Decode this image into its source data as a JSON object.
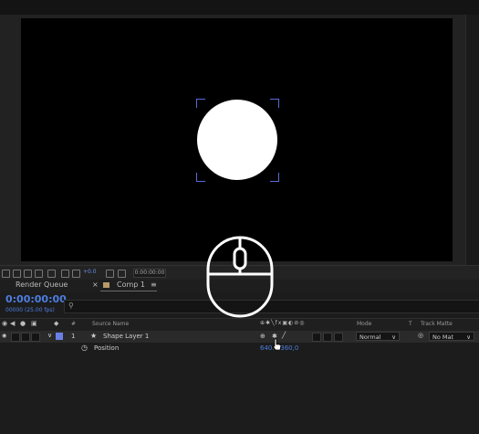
{
  "tabs": {
    "render_queue": "Render Queue",
    "close": "×",
    "comp": "Comp 1",
    "menu": "≡"
  },
  "viewer_toolbar": {
    "camera_value": "0:00:00:00",
    "magnify_label": "+0.0"
  },
  "timeline": {
    "timecode": "0:00:00:00",
    "frame_info": "00000 (25.00 fps)",
    "search_placeholder": ""
  },
  "columns": {
    "hash": "#",
    "source_name": "Source Name",
    "mode": "Mode",
    "t": "T",
    "track_matte": "Track Matte"
  },
  "layer": {
    "index": "1",
    "name": "Shape Layer 1",
    "label_color": "#6b7fe6",
    "mode_value": "Normal",
    "track_matte_value": "No Mat"
  },
  "property": {
    "name": "Position",
    "value": "640.0,360,0"
  },
  "colors": {
    "accent_blue": "#4d7ee0",
    "selection_bracket": "#5a6bd8"
  },
  "icons": [
    "eye-icon",
    "speaker-icon",
    "solo-icon",
    "lock-icon",
    "label-icon",
    "star-icon",
    "stopwatch-icon",
    "mouse-icon",
    "search-icon",
    "chevron-down-icon"
  ]
}
